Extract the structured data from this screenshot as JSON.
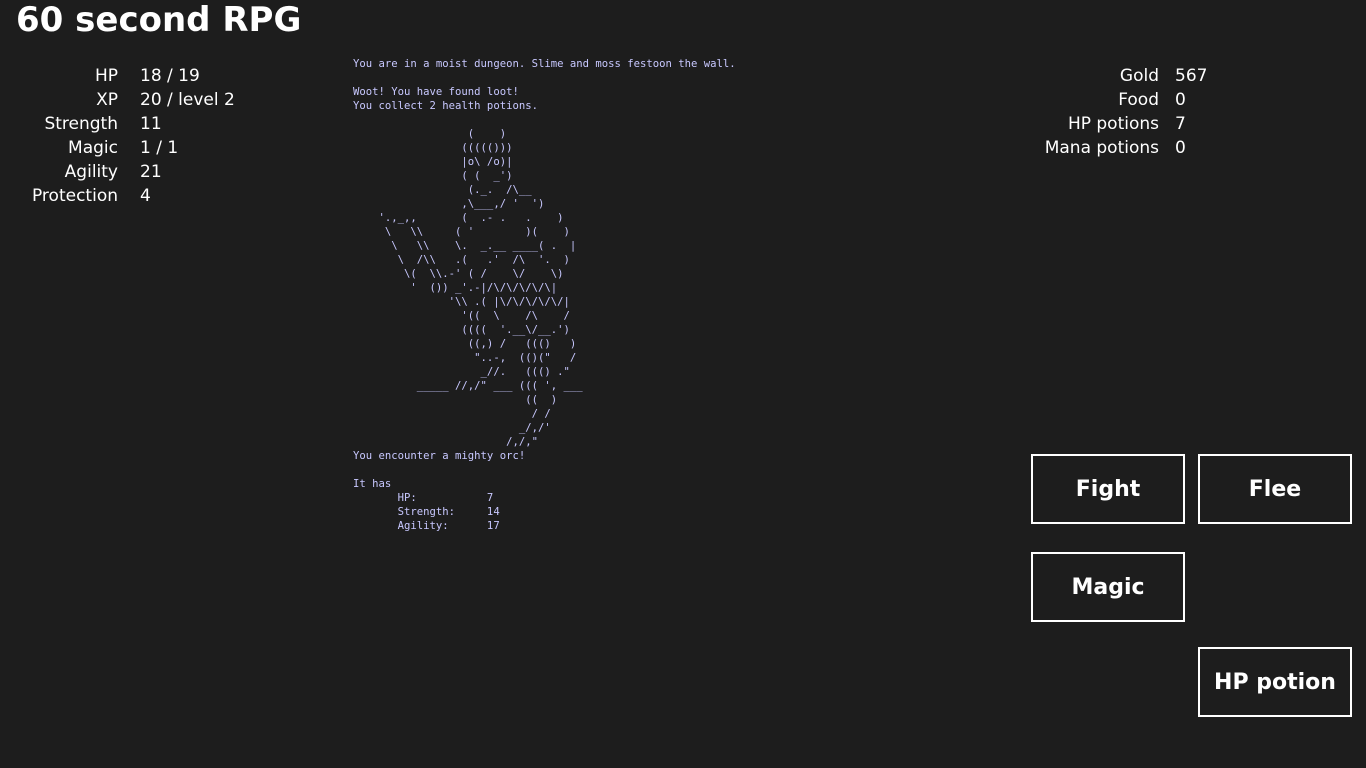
{
  "app": {
    "title": "60 second RPG"
  },
  "player_stats": [
    {
      "label": "HP",
      "value": "18 / 19"
    },
    {
      "label": "XP",
      "value": "20 / level 2"
    },
    {
      "label": "Strength",
      "value": "11"
    },
    {
      "label": "Magic",
      "value": "1 / 1"
    },
    {
      "label": "Agility",
      "value": "21"
    },
    {
      "label": "Protection",
      "value": "4"
    }
  ],
  "inventory": [
    {
      "label": "Gold",
      "value": "567"
    },
    {
      "label": "Food",
      "value": "0"
    },
    {
      "label": "HP potions",
      "value": "7"
    },
    {
      "label": "Mana potions",
      "value": "0"
    }
  ],
  "log": {
    "text": "You are in a moist dungeon. Slime and moss festoon the wall.\n\nWoot! You have found loot!\nYou collect 2 health potions.\n\n                  (    )\n                 ((((()))\n                 |o\\ /o)|\n                 ( (  _')\n                  (._.  /\\__\n                 ,\\___,/ '  ')\n    '.,_,,       (  .- .   .    )\n     \\   \\\\     ( '        )(    )\n      \\   \\\\    \\.  _.__ ____( .  |\n       \\  /\\\\   .(   .'  /\\  '.  )\n        \\(  \\\\.-' ( /    \\/    \\)\n         '  ()) _'.-|/\\/\\/\\/\\/\\|\n               '\\\\ .( |\\/\\/\\/\\/\\/|\n                 '((  \\    /\\    /\n                 ((((  '.__\\/__.')\n                  ((,) /   ((()   )\n                   \"..-,  (()(\"   /\n                    _//.   ((() .\"\n          _____ //,/\" ___ ((( ', ___\n                           ((  )\n                            / /\n                          _/,/'\n                        /,/,\"\nYou encounter a mighty orc!\n\nIt has\n       HP:           7\n       Strength:     14\n       Agility:      17"
  },
  "actions": {
    "fight": "Fight",
    "flee": "Flee",
    "magic": "Magic",
    "hp_potion": "HP potion"
  },
  "colors": {
    "background": "#1d1d1d",
    "text": "#ffffff",
    "log_text": "#c8c8ff"
  }
}
